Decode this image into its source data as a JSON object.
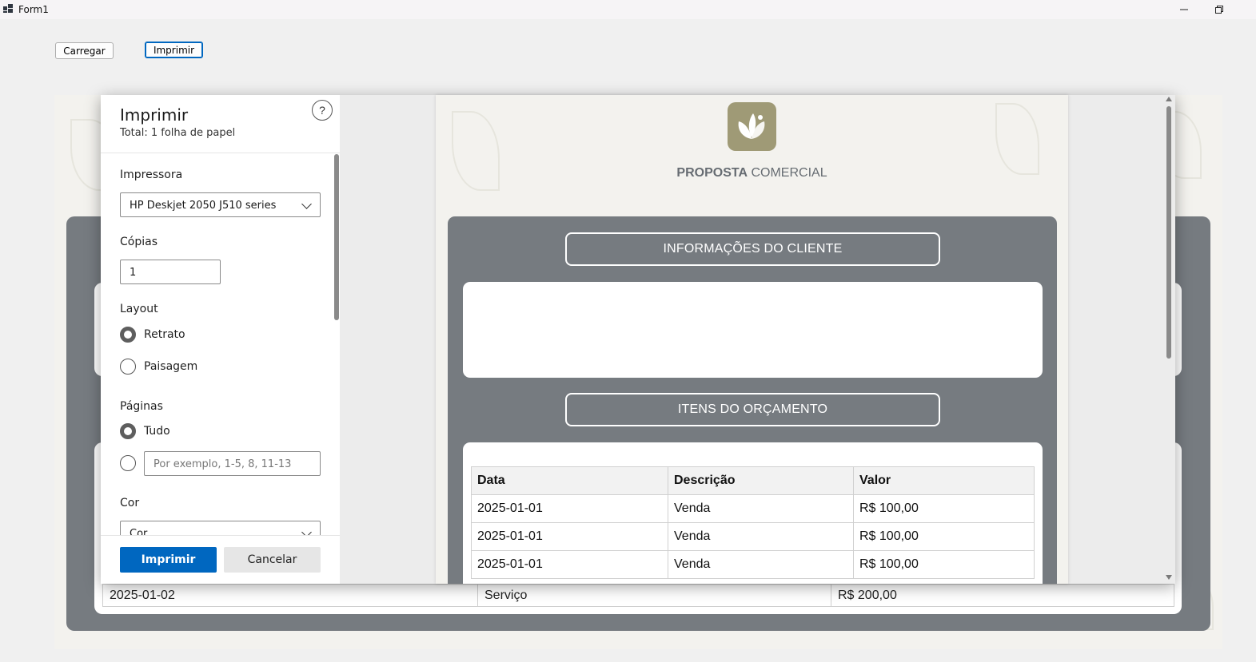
{
  "window": {
    "title": "Form1",
    "minimize": "—",
    "restore": "❐"
  },
  "toolbar": {
    "load_label": "Carregar",
    "print_label": "Imprimir"
  },
  "background": {
    "row": {
      "date": "2025-01-02",
      "description": "Serviço",
      "value": "R$ 200,00"
    }
  },
  "dialog": {
    "title": "Imprimir",
    "subtitle": "Total: 1 folha de papel",
    "help": "?",
    "printer_label": "Impressora",
    "printer_value": "HP Deskjet 2050 J510 series",
    "copies_label": "Cópias",
    "copies_value": "1",
    "layout_label": "Layout",
    "layout_options": [
      "Retrato",
      "Paisagem"
    ],
    "pages_label": "Páginas",
    "pages_options": [
      "Tudo"
    ],
    "pages_placeholder": "Por exemplo, 1-5, 8, 11-13",
    "color_label": "Cor",
    "color_value": "Cor",
    "print_button": "Imprimir",
    "cancel_button": "Cancelar"
  },
  "preview": {
    "title_bold": "PROPOSTA",
    "title_rest": " COMERCIAL",
    "client_section": "INFORMAÇÕES DO CLIENTE",
    "items_section": "ITENS DO ORÇAMENTO",
    "table": {
      "headers": [
        "Data",
        "Descrição",
        "Valor"
      ],
      "rows": [
        [
          "2025-01-01",
          "Venda",
          "R$ 100,00"
        ],
        [
          "2025-01-01",
          "Venda",
          "R$ 100,00"
        ],
        [
          "2025-01-01",
          "Venda",
          "R$ 100,00"
        ]
      ]
    }
  },
  "colors": {
    "accent": "#0067c0",
    "panel": "#767b80",
    "logo": "#9f9a76"
  }
}
